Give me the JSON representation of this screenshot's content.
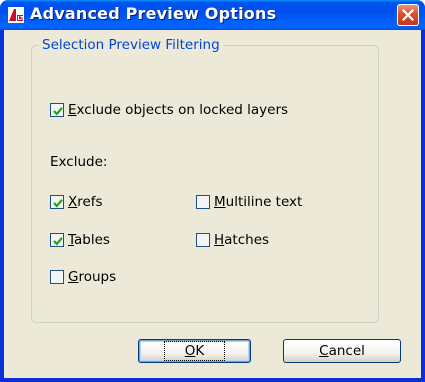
{
  "window": {
    "title": "Advanced Preview Options",
    "icon": "autocad-lt-icon"
  },
  "group": {
    "title": "Selection Preview Filtering"
  },
  "exclude_locked": {
    "mnemonic": "E",
    "rest": "xclude objects on locked layers",
    "checked": true
  },
  "exclude_label": "Exclude:",
  "options": {
    "xrefs": {
      "mnemonic": "X",
      "rest": "refs",
      "checked": true
    },
    "tables": {
      "mnemonic": "T",
      "rest": "ables",
      "checked": true
    },
    "groups": {
      "mnemonic": "G",
      "rest": "roups",
      "checked": false
    },
    "multiline": {
      "mnemonic": "M",
      "rest": "ultiline text",
      "checked": false
    },
    "hatches": {
      "mnemonic": "H",
      "rest": "atches",
      "checked": false
    }
  },
  "buttons": {
    "ok": {
      "mnemonic": "O",
      "rest": "K"
    },
    "cancel": {
      "mnemonic": "C",
      "rest": "ancel"
    }
  },
  "colors": {
    "titlebar": "#0054e3",
    "close": "#d8502e",
    "groupTitle": "#0046d5",
    "check": "#21a121",
    "face": "#ece9d8"
  }
}
